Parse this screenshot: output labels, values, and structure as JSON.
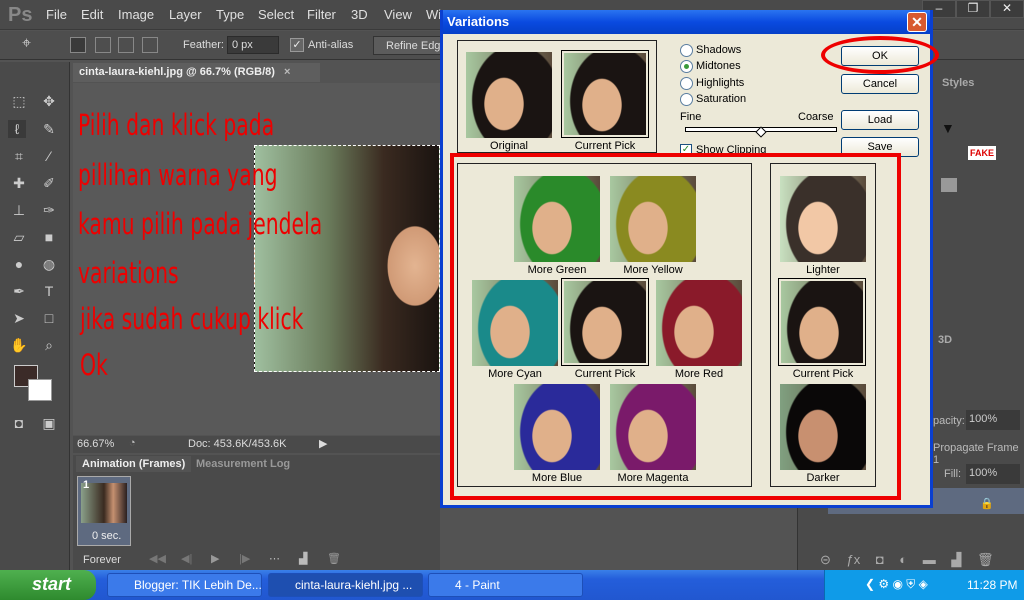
{
  "menubar": {
    "logo": "Ps",
    "items": [
      "File",
      "Edit",
      "Image",
      "Layer",
      "Type",
      "Select",
      "Filter",
      "3D",
      "View",
      "Wi"
    ]
  },
  "window_controls": [
    "–",
    "❐",
    "✕"
  ],
  "options": {
    "feather_label": "Feather:",
    "feather_value": "0 px",
    "antialias_label": "Anti-alias",
    "antialias_checked": true,
    "refine_edge": "Refine Edge"
  },
  "document": {
    "tab_title": "cinta-laura-kiehl.jpg @ 66.7% (RGB/8)",
    "tab_close": "×",
    "zoom": "66.67%",
    "doc_info": "Doc: 453.6K/453.6K"
  },
  "annotation": {
    "lines": [
      "Pilih dan klick pada",
      "pillihan warna yang",
      "kamu pilih pada jendela",
      "variations",
      "jika sudah cukup klick",
      "Ok"
    ],
    "color": "#e00000"
  },
  "animation": {
    "tabs": [
      "Animation (Frames)",
      "Measurement Log"
    ],
    "frame_number": "1",
    "frame_delay": "0 sec.",
    "loop": "Forever"
  },
  "right_panels": {
    "styles_tab": "Styles",
    "tab_3d": "3D",
    "opacity_label": "pacity:",
    "opacity_value": "100%",
    "propagate": "Propagate Frame 1",
    "fill_label": "Fill:",
    "fill_value": "100%",
    "fake_label": "FAKE"
  },
  "dialog": {
    "title": "Variations",
    "close": "✕",
    "original_label": "Original",
    "current_pick_label": "Current Pick",
    "tone_options": [
      {
        "label": "Shadows",
        "selected": false
      },
      {
        "label": "Midtones",
        "selected": true
      },
      {
        "label": "Highlights",
        "selected": false
      },
      {
        "label": "Saturation",
        "selected": false
      }
    ],
    "fine_label": "Fine",
    "coarse_label": "Coarse",
    "slider_position": 0.5,
    "show_clipping_label": "Show Clipping",
    "show_clipping_checked": true,
    "buttons": {
      "ok": "OK",
      "cancel": "Cancel",
      "load": "Load",
      "save": "Save"
    },
    "color_variations": [
      "More Green",
      "More Yellow",
      "More Cyan",
      "Current Pick",
      "More Red",
      "More Blue",
      "More Magenta"
    ],
    "brightness_variations": [
      "Lighter",
      "Current Pick",
      "Darker"
    ]
  },
  "taskbar": {
    "start": "start",
    "tasks": [
      "Blogger: TIK Lebih De...",
      "cinta-laura-kiehl.jpg ...",
      "4 - Paint"
    ],
    "clock": "11:28 PM"
  }
}
